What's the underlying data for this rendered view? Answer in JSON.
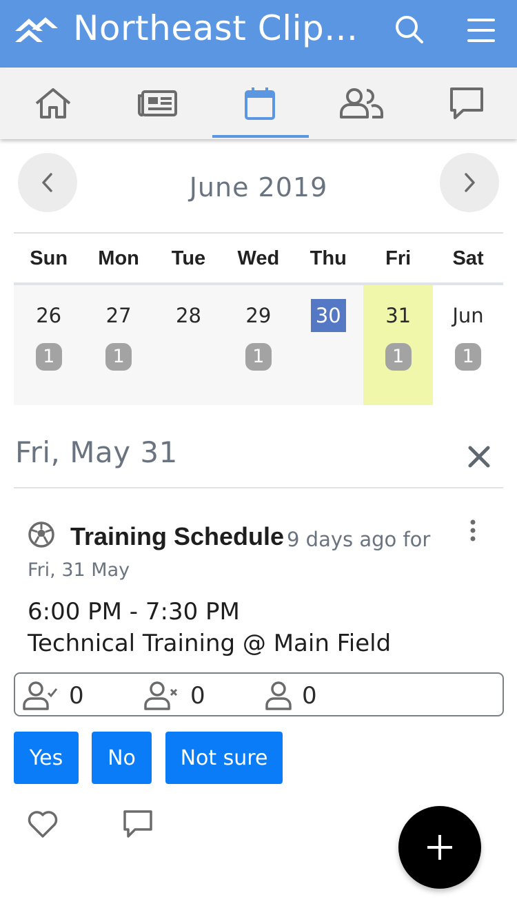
{
  "header": {
    "title": "Northeast Clip...",
    "accent_color": "#5b96e3",
    "logo_icon": "brand-chevrons-icon",
    "search_icon": "search-icon",
    "menu_icon": "hamburger-menu-icon"
  },
  "tabs": [
    {
      "icon": "home-icon",
      "active": false
    },
    {
      "icon": "news-icon",
      "active": false
    },
    {
      "icon": "calendar-icon",
      "active": true
    },
    {
      "icon": "people-icon",
      "active": false
    },
    {
      "icon": "chat-icon",
      "active": false
    }
  ],
  "calendar": {
    "month_title": "June 2019",
    "weekdays": [
      "Sun",
      "Mon",
      "Tue",
      "Wed",
      "Thu",
      "Fri",
      "Sat"
    ],
    "days": [
      {
        "label": "26",
        "badge": "1"
      },
      {
        "label": "27",
        "badge": "1"
      },
      {
        "label": "28",
        "badge": ""
      },
      {
        "label": "29",
        "badge": "1"
      },
      {
        "label": "30",
        "badge": "",
        "today": true
      },
      {
        "label": "31",
        "badge": "1",
        "selected": true
      },
      {
        "label": "Jun",
        "badge": "1"
      }
    ],
    "today_color": "#5478c4",
    "selected_color": "#f0f7ab"
  },
  "selected_day": {
    "title": "Fri, May 31"
  },
  "event": {
    "icon": "soccer-ball-icon",
    "title": "Training Schedule",
    "meta": "9 days ago for",
    "date": "Fri, 31 May",
    "time": "6:00 PM - 7:30 PM",
    "description": "Technical Training @ Main Field",
    "rsvp": {
      "going": "0",
      "not_going": "0",
      "no_response": "0"
    },
    "buttons": {
      "yes": "Yes",
      "no": "No",
      "not_sure": "Not sure"
    },
    "button_color": "#0a7cf8"
  }
}
